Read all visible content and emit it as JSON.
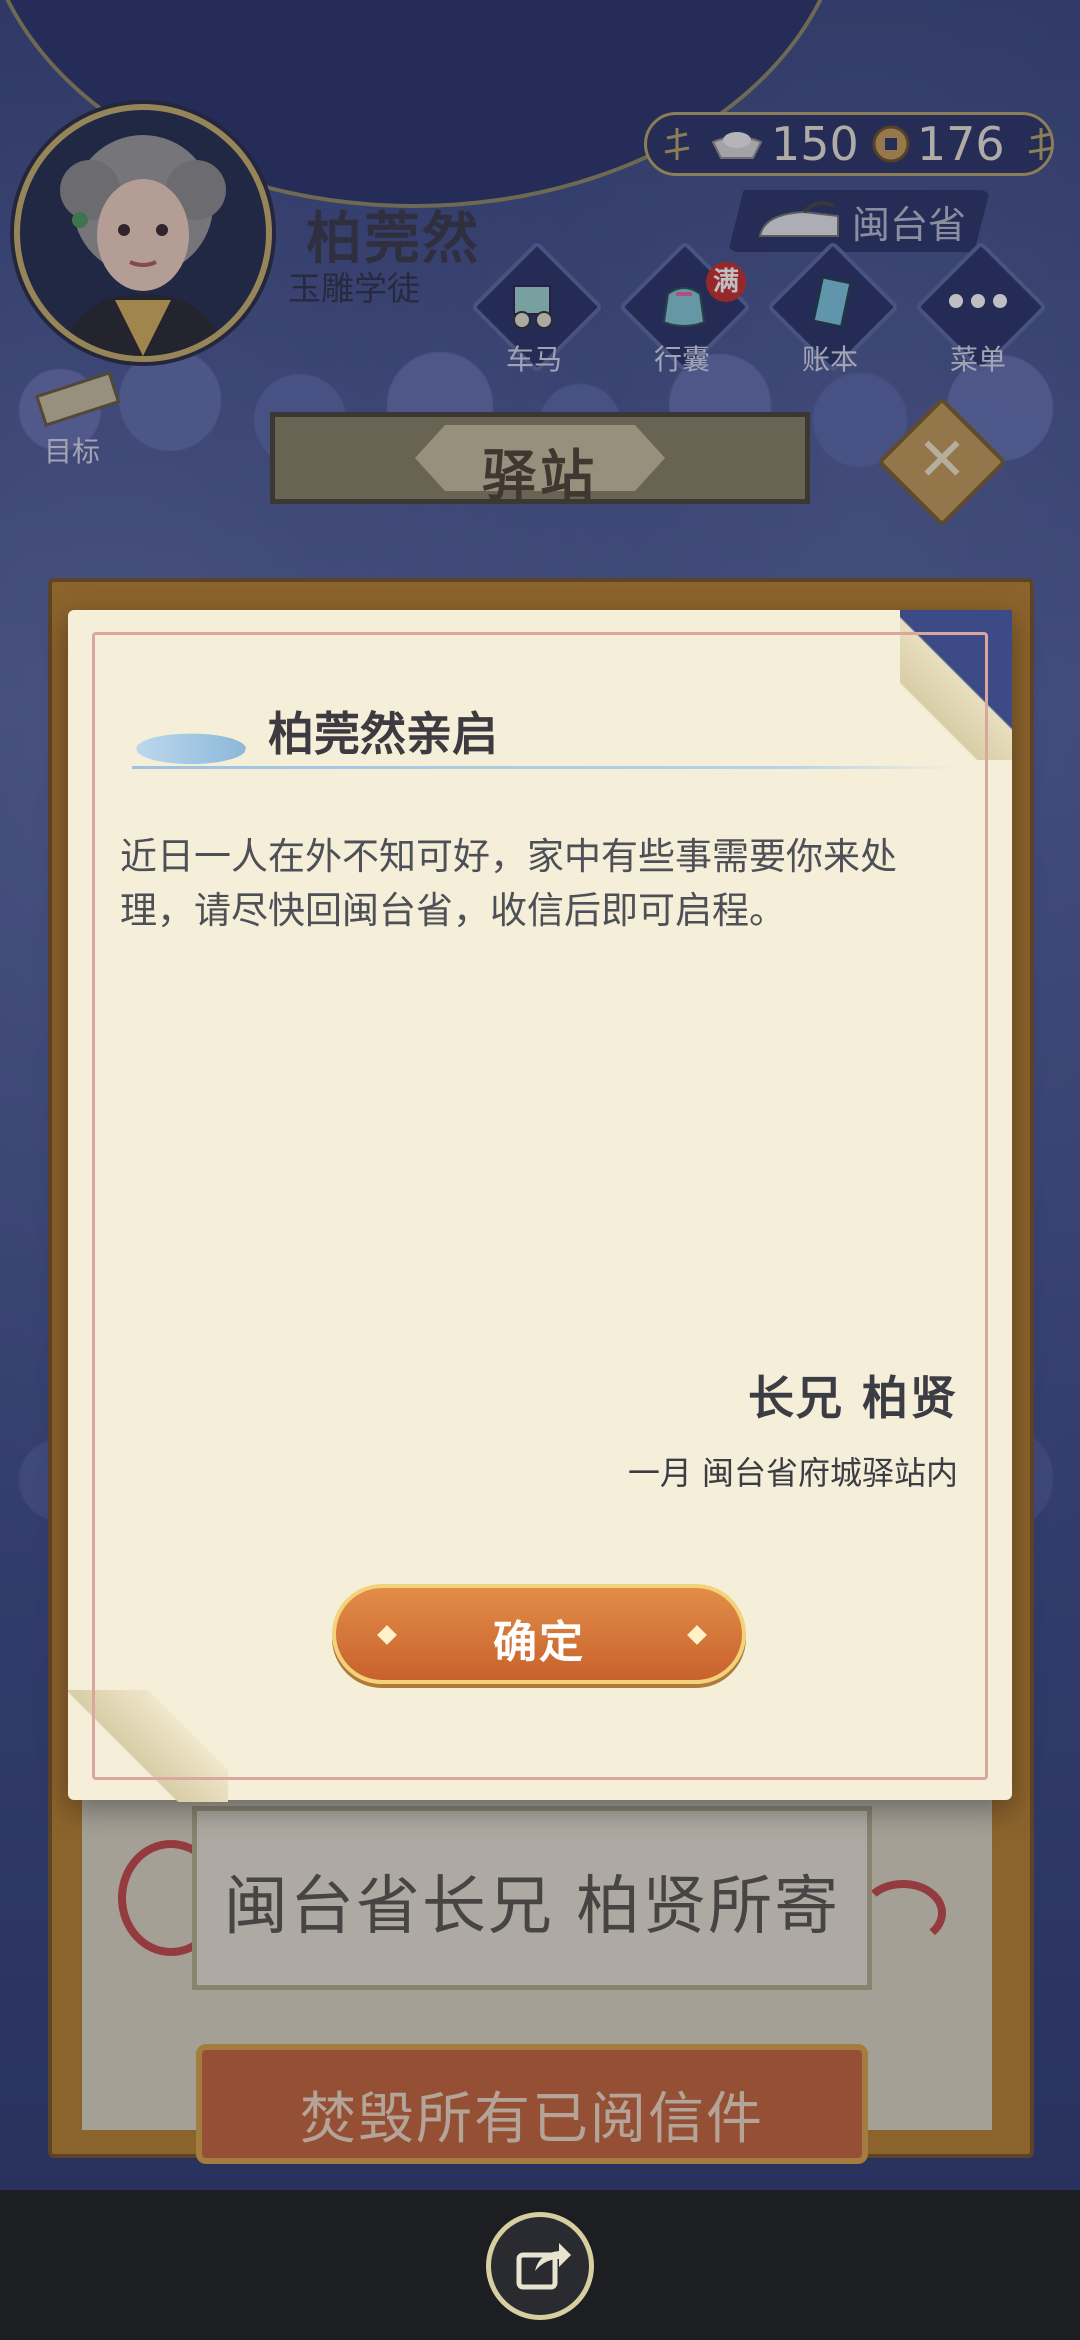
{
  "player": {
    "name": "柏莞然",
    "title": "玉雕学徒"
  },
  "currency": {
    "silver": "150",
    "coins": "176"
  },
  "location": {
    "province": "闽台省"
  },
  "nav": [
    {
      "label": "车马"
    },
    {
      "label": "行囊",
      "badge": "满"
    },
    {
      "label": "账本"
    },
    {
      "label": "菜单"
    }
  ],
  "goal": {
    "label": "目标"
  },
  "page": {
    "title": "驿站"
  },
  "letter": {
    "heading": "柏莞然亲启",
    "body": "近日一人在外不知可好，家中有些事需要你来处理，请尽快回闽台省，收信后即可启程。",
    "signer": "长兄 柏贤",
    "date_place": "一月 闽台省府城驿站内",
    "confirm": "确定"
  },
  "mailbox": {
    "envelope_label": "闽台省长兄 柏贤所寄",
    "burn_button": "焚毁所有已阅信件"
  },
  "icons": [
    "silver-ingot-icon",
    "copper-coin-icon",
    "iron-icon",
    "carriage-icon",
    "bag-icon",
    "ledger-icon",
    "menu-dots-icon",
    "scroll-icon",
    "close-icon",
    "share-icon"
  ]
}
